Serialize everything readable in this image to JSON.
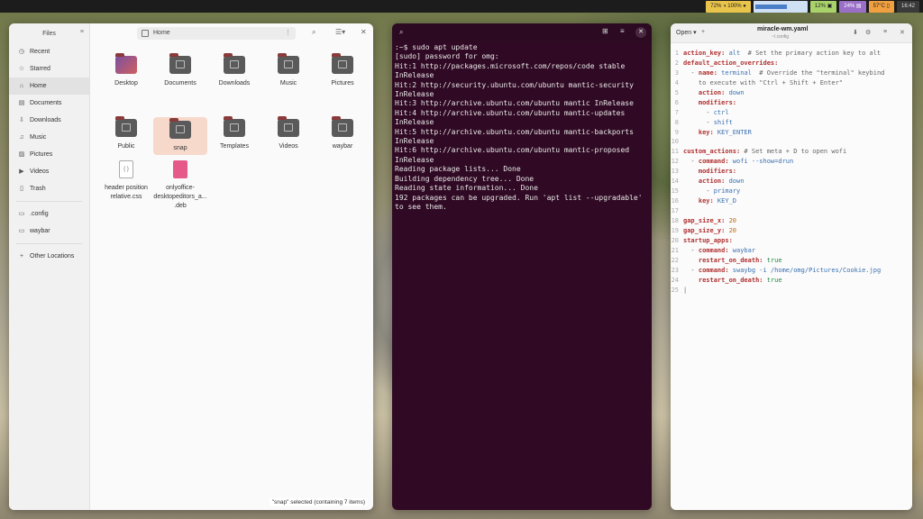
{
  "topbar": {
    "battery": "72% ◑ 100% ●",
    "volume_level": 0.62,
    "memory": "12% ▣",
    "cpu": "24% ▤",
    "temp": "57°C ▯",
    "time": "16:42"
  },
  "files": {
    "title": "Files",
    "path": "Home",
    "sidebar": [
      {
        "label": "Recent",
        "icon": "clock-icon"
      },
      {
        "label": "Starred",
        "icon": "star-icon"
      },
      {
        "label": "Home",
        "icon": "home-icon",
        "active": true
      },
      {
        "label": "Documents",
        "icon": "document-icon"
      },
      {
        "label": "Downloads",
        "icon": "download-icon"
      },
      {
        "label": "Music",
        "icon": "music-icon"
      },
      {
        "label": "Pictures",
        "icon": "picture-icon"
      },
      {
        "label": "Videos",
        "icon": "video-icon"
      },
      {
        "label": "Trash",
        "icon": "trash-icon"
      },
      {
        "label": ".config",
        "icon": "folder-icon"
      },
      {
        "label": "waybar",
        "icon": "folder-icon"
      },
      {
        "label": "Other Locations",
        "icon": "plus-icon"
      }
    ],
    "items": [
      {
        "label": "Desktop",
        "kind": "desktop"
      },
      {
        "label": "Documents",
        "kind": "folder"
      },
      {
        "label": "Downloads",
        "kind": "folder"
      },
      {
        "label": "Music",
        "kind": "folder"
      },
      {
        "label": "Pictures",
        "kind": "folder"
      },
      {
        "label": "Public",
        "kind": "folder"
      },
      {
        "label": "snap",
        "kind": "folder",
        "selected": true
      },
      {
        "label": "Templates",
        "kind": "folder"
      },
      {
        "label": "Videos",
        "kind": "folder"
      },
      {
        "label": "waybar",
        "kind": "folder"
      },
      {
        "label": "header position relative.css",
        "kind": "css"
      },
      {
        "label": "onlyoffice-desktopeditors_a... .deb",
        "kind": "deb"
      }
    ],
    "status": "\"snap\" selected (containing 7 items)"
  },
  "terminal": {
    "lines": [
      ":~$ sudo apt update",
      "[sudo] password for omg:",
      "Hit:1 http://packages.microsoft.com/repos/code stable InRelease",
      "Hit:2 http://security.ubuntu.com/ubuntu mantic-security InRelease",
      "Hit:3 http://archive.ubuntu.com/ubuntu mantic InRelease",
      "Hit:4 http://archive.ubuntu.com/ubuntu mantic-updates InRelease",
      "Hit:5 http://archive.ubuntu.com/ubuntu mantic-backports InRelease",
      "Hit:6 http://archive.ubuntu.com/ubuntu mantic-proposed InRelease",
      "Reading package lists... Done",
      "Building dependency tree... Done",
      "Reading state information... Done",
      "192 packages can be upgraded. Run 'apt list --upgradable' to see them."
    ]
  },
  "editor": {
    "open_label": "Open",
    "filename": "miracle-wm.yaml",
    "subtitle": "~/.config",
    "lines": [
      [
        [
          "k",
          "action_key:"
        ],
        [
          "v",
          " alt"
        ],
        [
          "c",
          "  # Set the primary action key to alt"
        ]
      ],
      [
        [
          "k",
          "default_action_overrides:"
        ]
      ],
      [
        [
          "c",
          "  - "
        ],
        [
          "k",
          "name:"
        ],
        [
          "v",
          " terminal"
        ],
        [
          "c",
          "  # Override the \"terminal\" keybind"
        ]
      ],
      [
        [
          "c",
          "    to execute with \"Ctrl + Shift + Enter\""
        ]
      ],
      [
        [
          "k",
          "    action:"
        ],
        [
          "v",
          " down"
        ]
      ],
      [
        [
          "k",
          "    modifiers:"
        ]
      ],
      [
        [
          "c",
          "      - "
        ],
        [
          "v",
          "ctrl"
        ]
      ],
      [
        [
          "c",
          "      - "
        ],
        [
          "v",
          "shift"
        ]
      ],
      [
        [
          "k",
          "    key:"
        ],
        [
          "v",
          " KEY_ENTER"
        ]
      ],
      [
        [
          "c",
          ""
        ]
      ],
      [
        [
          "k",
          "custom_actions:"
        ],
        [
          "c",
          " # Set meta + D to open wofi"
        ]
      ],
      [
        [
          "c",
          "  - "
        ],
        [
          "k",
          "command:"
        ],
        [
          "v",
          " wofi --show=drun"
        ]
      ],
      [
        [
          "k",
          "    modifiers:"
        ]
      ],
      [
        [
          "k",
          "    action:"
        ],
        [
          "v",
          " down"
        ]
      ],
      [
        [
          "c",
          "      - "
        ],
        [
          "v",
          "primary"
        ]
      ],
      [
        [
          "k",
          "    key:"
        ],
        [
          "v",
          " KEY_D"
        ]
      ],
      [
        [
          "c",
          ""
        ]
      ],
      [
        [
          "k",
          "gap_size_x:"
        ],
        [
          "d",
          " 20"
        ]
      ],
      [
        [
          "k",
          "gap_size_y:"
        ],
        [
          "d",
          " 20"
        ]
      ],
      [
        [
          "k",
          "startup_apps:"
        ]
      ],
      [
        [
          "c",
          "  - "
        ],
        [
          "k",
          "command:"
        ],
        [
          "v",
          " waybar"
        ]
      ],
      [
        [
          "k",
          "    restart_on_death:"
        ],
        [
          "n",
          " true"
        ]
      ],
      [
        [
          "c",
          "  - "
        ],
        [
          "k",
          "command:"
        ],
        [
          "v",
          " swaybg -i /home/omg/Pictures/Cookie.jpg"
        ]
      ],
      [
        [
          "k",
          "    restart_on_death:"
        ],
        [
          "n",
          " true"
        ]
      ],
      [
        [
          "c",
          "|"
        ]
      ]
    ]
  }
}
